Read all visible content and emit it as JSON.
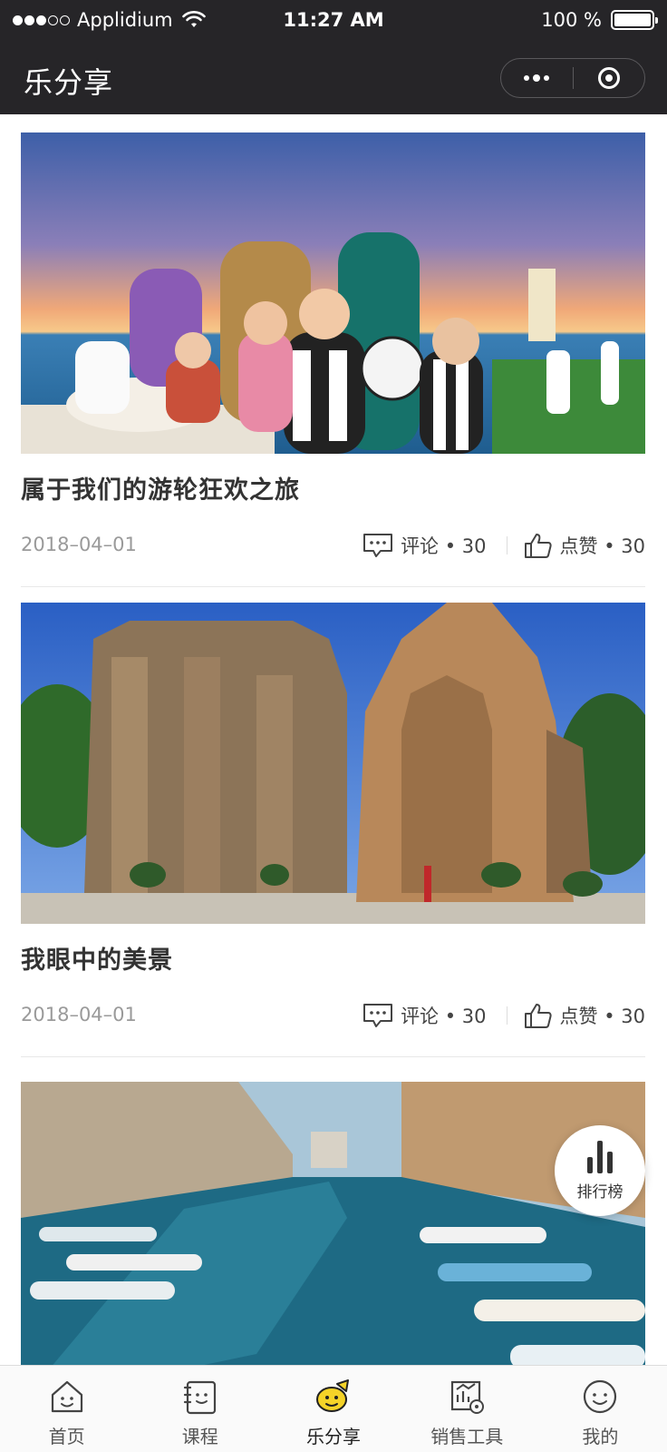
{
  "status_bar": {
    "carrier": "Applidium",
    "time": "11:27 AM",
    "battery": "100 %"
  },
  "nav": {
    "title": "乐分享"
  },
  "posts": [
    {
      "title": "属于我们的游轮狂欢之旅",
      "date": "2018–04–01",
      "comment_label": "评论 • 30",
      "like_label": "点赞 • 30"
    },
    {
      "title": "我眼中的美景",
      "date": "2018–04–01",
      "comment_label": "评论 • 30",
      "like_label": "点赞 • 30"
    },
    {
      "title": "",
      "date": "",
      "comment_label": "",
      "like_label": ""
    }
  ],
  "ranking": {
    "label": "排行榜"
  },
  "tabs": [
    {
      "label": "首页",
      "icon": "home-icon"
    },
    {
      "label": "课程",
      "icon": "course-icon"
    },
    {
      "label": "乐分享",
      "icon": "share-icon",
      "active": true
    },
    {
      "label": "销售工具",
      "icon": "sales-tool-icon"
    },
    {
      "label": "我的",
      "icon": "profile-icon"
    }
  ],
  "colors": {
    "header_bg": "#262528",
    "active_tab": "#f5d328",
    "text": "#333333",
    "muted": "#9a9a9a"
  }
}
